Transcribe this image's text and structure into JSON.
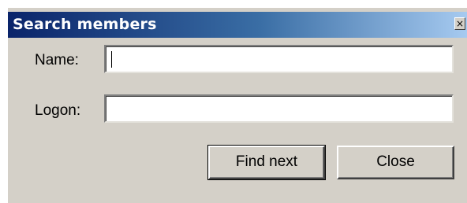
{
  "window": {
    "title": "Search members",
    "close_glyph": "×"
  },
  "form": {
    "name_label": "Name:",
    "name_value": "",
    "logon_label": "Logon:",
    "logon_value": ""
  },
  "buttons": {
    "find_next": "Find next",
    "close": "Close"
  },
  "colors": {
    "titlebar_start": "#0a246a",
    "titlebar_end": "#a6caf0",
    "dialog_bg": "#d4d0c8"
  }
}
